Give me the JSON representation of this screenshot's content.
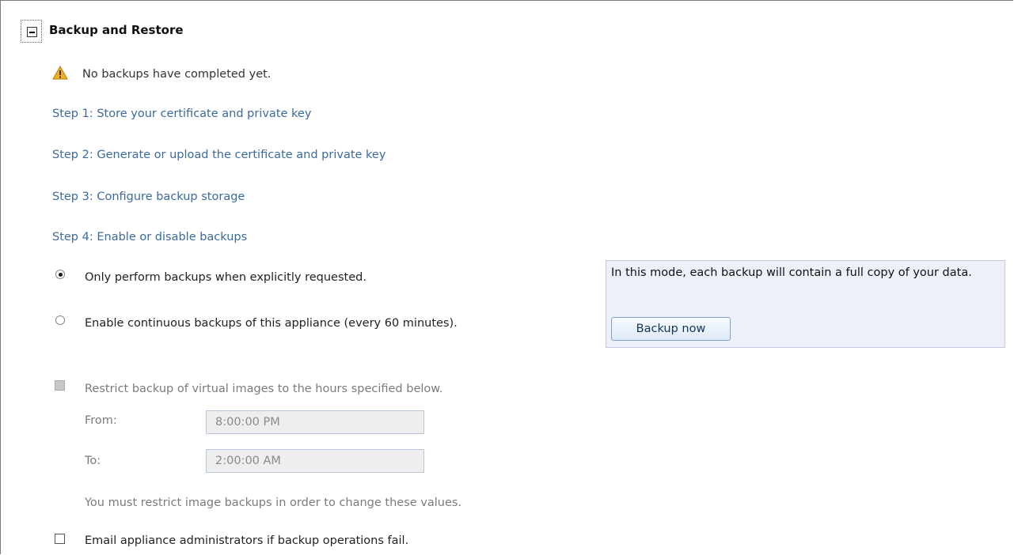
{
  "section": {
    "title": "Backup and Restore"
  },
  "status": {
    "warning_text": "No backups have completed yet."
  },
  "steps": [
    "Step 1: Store your certificate and private key",
    "Step 2: Generate or upload the certificate and private key",
    "Step 3: Configure backup storage",
    "Step 4: Enable or disable backups"
  ],
  "backup_mode": {
    "options": [
      {
        "label": "Only perform backups when explicitly requested.",
        "selected": true
      },
      {
        "label": "Enable continuous backups of this appliance (every 60 minutes).",
        "selected": false
      }
    ]
  },
  "info_panel": {
    "text": "In this mode, each backup will contain a full copy of your data.",
    "button_label": "Backup now"
  },
  "restrict": {
    "label": "Restrict backup of virtual images to the hours specified below.",
    "checked": false,
    "disabled": true,
    "from_label": "From:",
    "from_value": "8:00:00 PM",
    "to_label": "To:",
    "to_value": "2:00:00 AM",
    "note": "You must restrict image backups in order to change these values."
  },
  "email": {
    "label": "Email appliance administrators if backup operations fail.",
    "checked": false
  },
  "colors": {
    "link": "#3c6a9a",
    "panel_bg": "#eef0f9",
    "warning": "#f2b01e"
  },
  "icons": {
    "toggle": "collapse-minus-icon",
    "warning": "warning-icon"
  }
}
